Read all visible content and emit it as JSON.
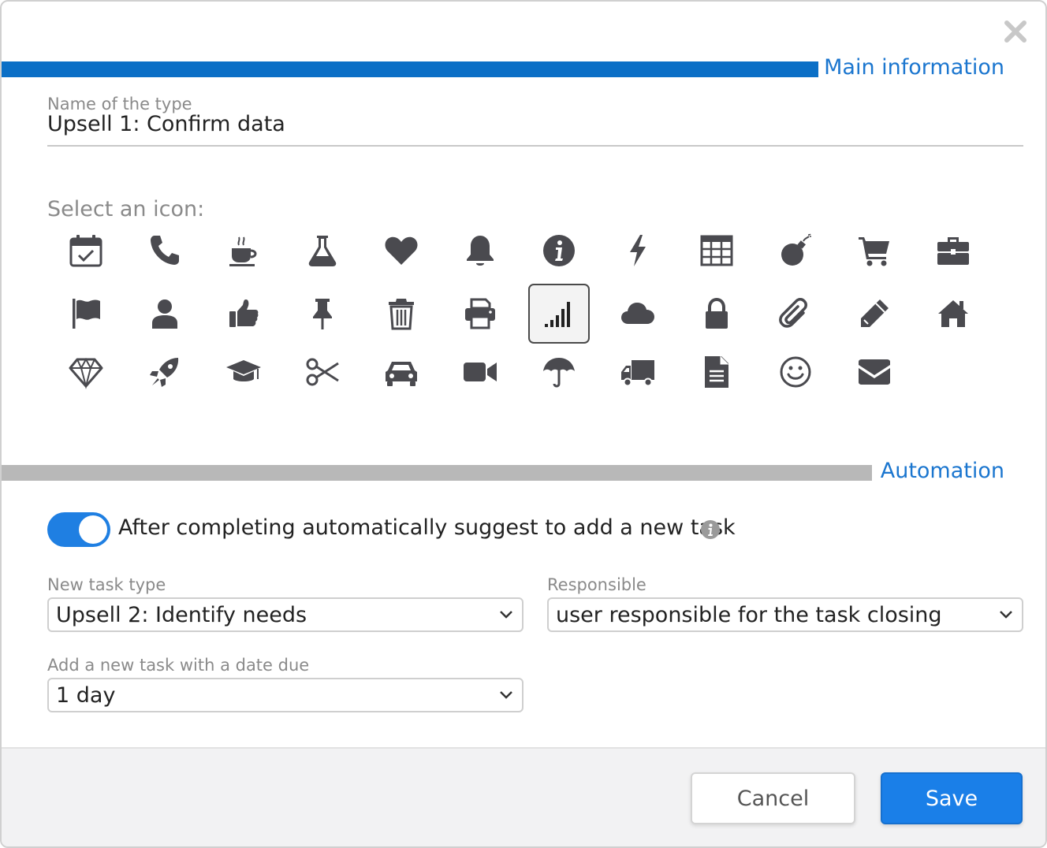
{
  "dialog": {
    "main_section_title": "Main information",
    "name_label": "Name of the type",
    "name_value": "Upsell 1: Confirm data",
    "icon_picker_label": "Select an icon:",
    "icons": [
      "calendar-check-icon",
      "phone-icon",
      "coffee-icon",
      "flask-icon",
      "heart-icon",
      "bell-icon",
      "info-circle-icon",
      "bolt-icon",
      "table-icon",
      "bomb-icon",
      "shopping-cart-icon",
      "briefcase-icon",
      "flag-icon",
      "user-icon",
      "thumbs-up-icon",
      "pushpin-icon",
      "trash-icon",
      "print-icon",
      "signal-icon",
      "cloud-icon",
      "lock-icon",
      "paperclip-icon",
      "pencil-icon",
      "home-icon",
      "diamond-icon",
      "rocket-icon",
      "graduation-cap-icon",
      "scissors-icon",
      "car-icon",
      "video-camera-icon",
      "umbrella-icon",
      "truck-icon",
      "document-icon",
      "smile-icon",
      "envelope-icon"
    ],
    "selected_icon": "signal-icon",
    "automation_section_title": "Automation",
    "auto_suggest_toggle_on": true,
    "auto_suggest_label": "After completing automatically suggest to add a new task",
    "new_task_type_label": "New task type",
    "new_task_type_value": "Upsell 2: Identify needs",
    "responsible_label": "Responsible",
    "responsible_value": "user responsible for the task closing",
    "due_label": "Add a new task with a date due",
    "due_value": "1 day",
    "cancel_label": "Cancel",
    "save_label": "Save"
  },
  "colors": {
    "accent": "#1b76cf",
    "main_bar": "#0b6fc6",
    "automation_bar": "#b8b8b8",
    "toggle_on": "#1f7fe2",
    "save_button": "#1a7fe8",
    "icon": "#4a4a4f"
  }
}
